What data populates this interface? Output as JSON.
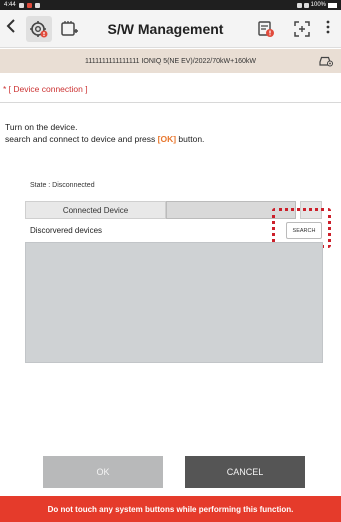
{
  "status_bar": {
    "time": "4:44",
    "battery": "100%"
  },
  "toolbar": {
    "back_icon": "chevron-left-icon",
    "title": "S/W Management"
  },
  "vehicle": {
    "info": "1111111111111111 IONIQ 5(NE EV)/2022/70kW+160kW"
  },
  "section": {
    "title": "* [ Device connection ]"
  },
  "instructions": {
    "line1": "Turn on the device.",
    "line2_pre": "search and connect to device and press ",
    "line2_ok": "[OK]",
    "line2_post": " button."
  },
  "connection": {
    "state": "State : Disconnected",
    "connected_device_label": "Connected Device",
    "connected_device_value": "",
    "discovered_label": "Discorvered devices",
    "search_label": "SEARCH"
  },
  "buttons": {
    "ok": "OK",
    "cancel": "CANCEL"
  },
  "warning": {
    "text": "Do not touch any system buttons while performing this function."
  },
  "colors": {
    "accent": "#e8772e",
    "warning_bg": "#e53b2b",
    "section_title": "#cc3333",
    "highlight": "#cc1f2a"
  }
}
